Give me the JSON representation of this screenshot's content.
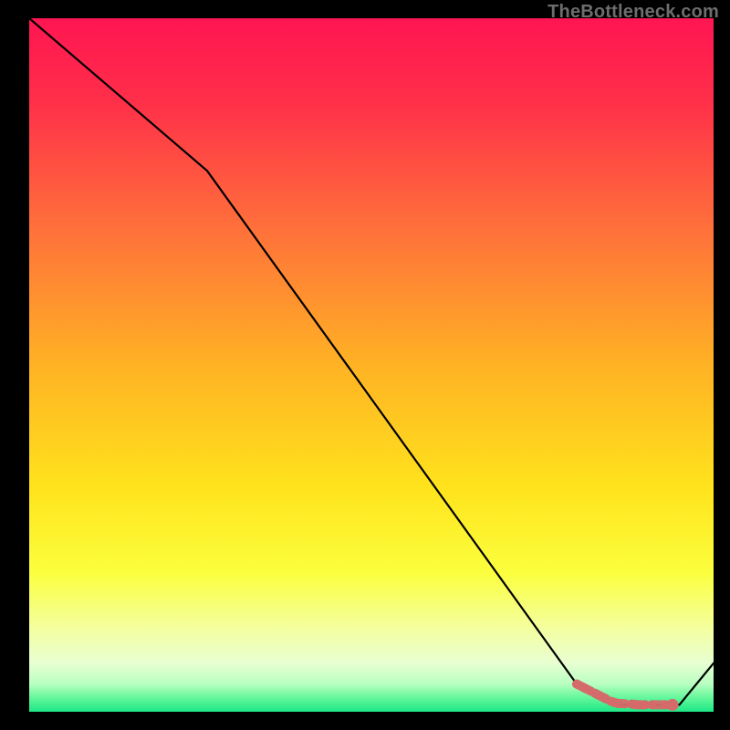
{
  "watermark": {
    "text": "TheBottleneck.com"
  },
  "colors": {
    "frame": "#000000",
    "line": "#000000",
    "marker": "#d46a6a",
    "gradient_stops": [
      {
        "pct": 0,
        "color": "#ff1552"
      },
      {
        "pct": 12,
        "color": "#ff2f49"
      },
      {
        "pct": 30,
        "color": "#ff6f3b"
      },
      {
        "pct": 50,
        "color": "#ffb224"
      },
      {
        "pct": 68,
        "color": "#ffe41c"
      },
      {
        "pct": 80,
        "color": "#fbff3e"
      },
      {
        "pct": 88,
        "color": "#f4ffa0"
      },
      {
        "pct": 93,
        "color": "#e8ffd2"
      },
      {
        "pct": 96,
        "color": "#b8ffc0"
      },
      {
        "pct": 98,
        "color": "#63f79a"
      },
      {
        "pct": 100,
        "color": "#1de886"
      }
    ]
  },
  "chart_data": {
    "type": "line",
    "title": "",
    "xlabel": "",
    "ylabel": "",
    "xlim": [
      0,
      100
    ],
    "ylim": [
      0,
      100
    ],
    "grid": false,
    "legend": false,
    "series": [
      {
        "name": "curve",
        "x": [
          0,
          26,
          80,
          85,
          90,
          95,
          100
        ],
        "y": [
          100,
          78,
          4,
          1,
          1,
          1,
          7
        ]
      }
    ],
    "markers": {
      "name": "highlight-segment",
      "x": [
        80,
        81,
        82,
        83,
        84,
        85,
        86,
        88,
        89,
        90,
        91,
        93,
        94
      ],
      "y": [
        4.0,
        3.5,
        3.0,
        2.5,
        2.0,
        1.5,
        1.2,
        1.1,
        1.0,
        1.0,
        1.0,
        1.0,
        1.0
      ]
    }
  }
}
